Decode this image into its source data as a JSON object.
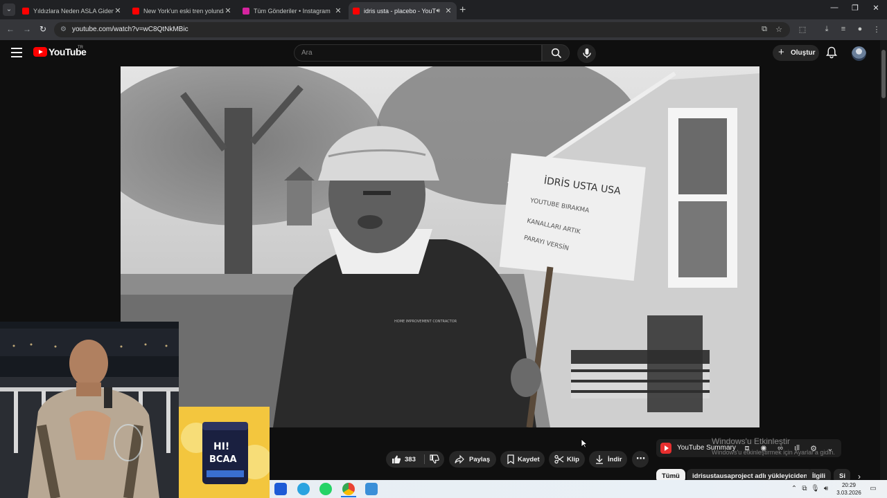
{
  "browser": {
    "tabs": [
      {
        "label": "Yıldızlara Neden ASLA Gidemeyiz",
        "favicon_color": "#ff0000",
        "active": false
      },
      {
        "label": "New York'un eski tren yolunda yürüdüm",
        "favicon_color": "#ff0000",
        "active": false
      },
      {
        "label": "Tüm Gönderiler • Instagram",
        "favicon_color": "#d6249f",
        "active": false
      },
      {
        "label": "idris usta - placebo - YouTube",
        "favicon_color": "#ff0000",
        "active": true
      }
    ],
    "url": "youtube.com/watch?v=wC8QtNkMBic"
  },
  "yt": {
    "logo_text": "YouTube",
    "country_code": "TR",
    "search_placeholder": "Ara",
    "create_label": "Oluştur",
    "actions": {
      "likes": "383",
      "share": "Paylaş",
      "save": "Kaydet",
      "clip": "Klip",
      "download": "İndir"
    },
    "summary_title": "YouTube Summary",
    "chips": [
      "Tümü",
      "idrisustausaproject adlı yükleyiciden",
      "İlgili",
      "Si"
    ]
  },
  "video": {
    "sign_lines": [
      "İDRİS USTA USA",
      "YOUTUBE BIRAKMA",
      "KANALLARI ARTIK",
      "PARAYI VERSİN"
    ],
    "vest_text": "HOME IMPROVEMENT CONTRACTOR"
  },
  "ad": {
    "product": "BCAA",
    "brand": "HI!"
  },
  "watermark": {
    "line1": "Windows'u Etkinleştir",
    "line2": "Windows'u etkinleştirmek için Ayarlar'a gidin."
  },
  "taskbar": {
    "time": "20:29",
    "date": "3.03.2026"
  }
}
